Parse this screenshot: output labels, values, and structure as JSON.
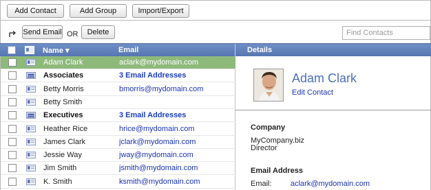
{
  "toolbar": {
    "add_contact": "Add Contact",
    "add_group": "Add Group",
    "import_export": "Import/Export"
  },
  "actions": {
    "send_email": "Send Email",
    "or": "OR",
    "delete": "Delete",
    "search_placeholder": "Find Contacts"
  },
  "header": {
    "name": "Name ▾",
    "email": "Email",
    "details": "Details"
  },
  "rows": [
    {
      "name": "Adam Clark",
      "email": "aclark@mydomain.com",
      "type": "contact",
      "selected": true
    },
    {
      "name": "Associates",
      "email": "3 Email Addresses",
      "type": "group",
      "selected": false
    },
    {
      "name": "Betty Morris",
      "email": "bmorris@mydomain.com",
      "type": "contact",
      "selected": false
    },
    {
      "name": "Betty Smith",
      "email": "",
      "type": "contact",
      "selected": false
    },
    {
      "name": "Executives",
      "email": "3 Email Addresses",
      "type": "group",
      "selected": false
    },
    {
      "name": "Heather Rice",
      "email": "hrice@mydomain.com",
      "type": "contact",
      "selected": false
    },
    {
      "name": "James Clark",
      "email": "jclark@mydomain.com",
      "type": "contact",
      "selected": false
    },
    {
      "name": "Jessie Way",
      "email": "jway@mydomain.com",
      "type": "contact",
      "selected": false
    },
    {
      "name": "Jim Smith",
      "email": "jsmith@mydomain.com",
      "type": "contact",
      "selected": false
    },
    {
      "name": "K. Smith",
      "email": "ksmith@mydomain.com",
      "type": "contact",
      "selected": false
    }
  ],
  "details": {
    "name": "Adam Clark",
    "edit": "Edit Contact",
    "company_title": "Company",
    "company_name": "MyCompany.biz",
    "company_role": "Director",
    "email_title": "Email Address",
    "email_label": "Email:",
    "email_value": "aclark@mydomain.com"
  },
  "colors": {
    "header_blue": "#5f7fbb",
    "selected_green": "#8dba7b",
    "link_blue": "#1a33b3"
  }
}
